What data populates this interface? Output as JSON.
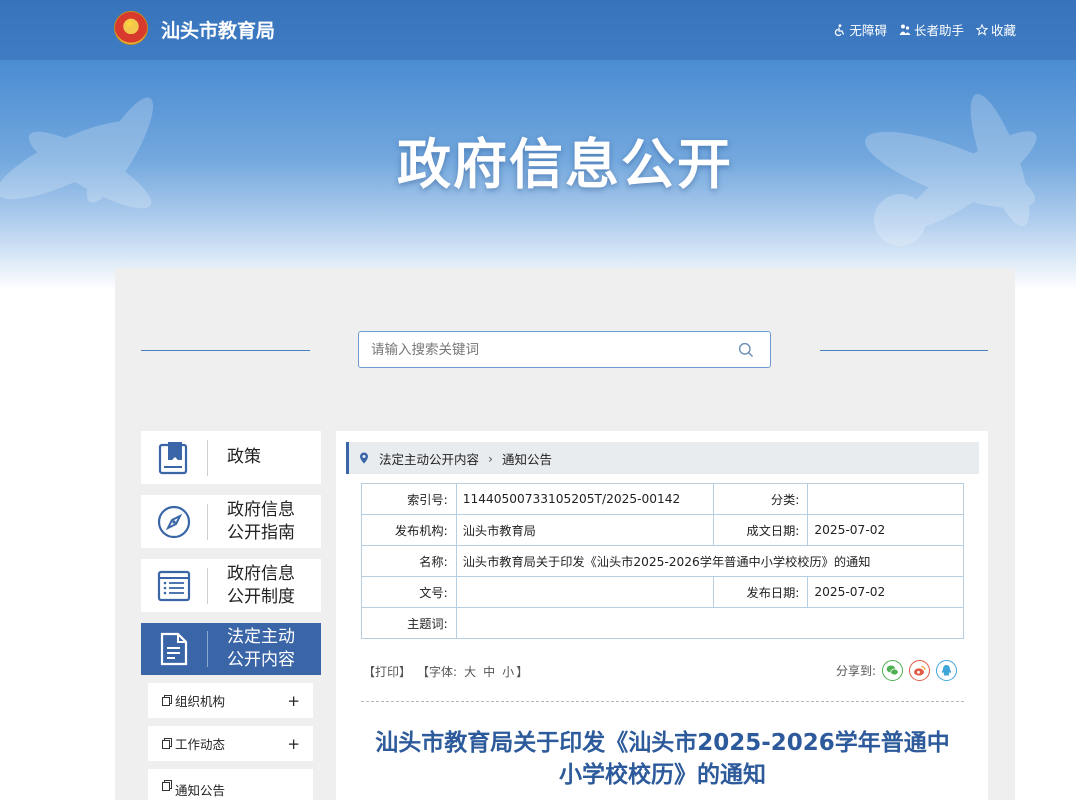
{
  "header": {
    "site_name": "汕头市教育局",
    "links": [
      {
        "label": "无障碍",
        "icon": "accessibility-icon"
      },
      {
        "label": "长者助手",
        "icon": "elder-assist-icon"
      },
      {
        "label": "收藏",
        "icon": "star-icon"
      }
    ],
    "hero_title": "政府信息公开"
  },
  "search": {
    "placeholder": "请输入搜索关键词",
    "value": ""
  },
  "sidebar": {
    "items": [
      {
        "label": "政策",
        "icon": "policy-book-icon",
        "active": false
      },
      {
        "label": "政府信息\n公开指南",
        "icon": "compass-icon",
        "active": false
      },
      {
        "label": "政府信息\n公开制度",
        "icon": "list-document-icon",
        "active": false
      },
      {
        "label": "法定主动\n公开内容",
        "icon": "document-icon",
        "active": true
      }
    ],
    "sub_items": [
      {
        "label": "组织机构",
        "expand": "+"
      },
      {
        "label": "工作动态",
        "expand": "+"
      },
      {
        "label": "通知公告",
        "expand": ""
      }
    ]
  },
  "breadcrumb": {
    "items": [
      "法定主动公开内容",
      "通知公告"
    ],
    "separator": "›"
  },
  "meta": {
    "index_label": "索引号:",
    "index_value": "11440500733105205T/2025-00142",
    "category_label": "分类:",
    "category_value": "",
    "publisher_label": "发布机构:",
    "publisher_value": "汕头市教育局",
    "written_date_label": "成文日期:",
    "written_date_value": "2025-07-02",
    "name_label": "名称:",
    "name_value": "汕头市教育局关于印发《汕头市2025-2026学年普通中小学校校历》的通知",
    "doc_no_label": "文号:",
    "doc_no_value": "",
    "publish_date_label": "发布日期:",
    "publish_date_value": "2025-07-02",
    "subject_label": "主题词:",
    "subject_value": ""
  },
  "tools": {
    "print": "【打印】",
    "font_prefix": "【字体:",
    "font_large": "大",
    "font_medium": "中",
    "font_small": "小",
    "font_suffix": "】",
    "share_label": "分享到:"
  },
  "document": {
    "title_line1": "汕头市教育局关于印发《汕头市2025-2026学年普通中",
    "title_line2": "小学校校历》的通知"
  },
  "colors": {
    "brand_blue": "#3a66a8",
    "title_blue": "#2d5a9b",
    "wechat_green": "#4caf50",
    "weibo_red": "#e05a45",
    "qq_blue": "#3fa5d8"
  }
}
